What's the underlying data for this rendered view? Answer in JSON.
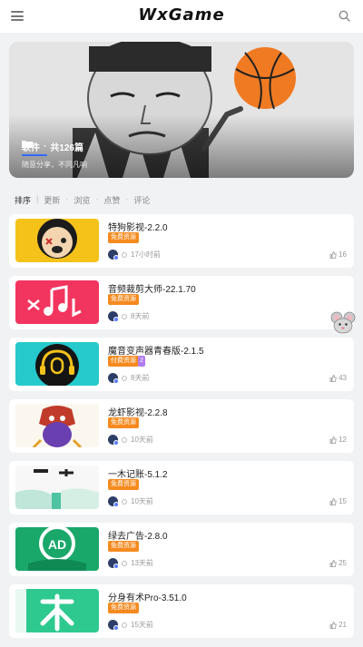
{
  "header": {
    "logo": "WxGame"
  },
  "banner": {
    "category": "软件",
    "count": "共126篇",
    "subtitle": "随意分享，不同凡响"
  },
  "sortbar": {
    "label": "排序",
    "options": [
      "更新",
      "浏览",
      "点赞",
      "评论"
    ]
  },
  "items": [
    {
      "title": "特狗影视-2.2.0",
      "tag": "免费资源",
      "time": "17小时前",
      "likes": "16"
    },
    {
      "title": "音频裁剪大师-22.1.70",
      "tag": "免费资源",
      "time": "8天前",
      "likes": ""
    },
    {
      "title": "魔音变声器青春版-2.1.5",
      "tag": "付费资源",
      "badge": "2",
      "time": "8天前",
      "likes": "43"
    },
    {
      "title": "龙虾影视-2.2.8",
      "tag": "免费资源",
      "time": "10天前",
      "likes": "12"
    },
    {
      "title": "一木记账-5.1.2",
      "tag": "免费资源",
      "time": "10天前",
      "likes": "15"
    },
    {
      "title": "绿去广告-2.8.0",
      "tag": "免费资源",
      "time": "13天前",
      "likes": "25"
    },
    {
      "title": "分身有术Pro-3.51.0",
      "tag": "免费资源",
      "time": "15天前",
      "likes": "21"
    }
  ]
}
